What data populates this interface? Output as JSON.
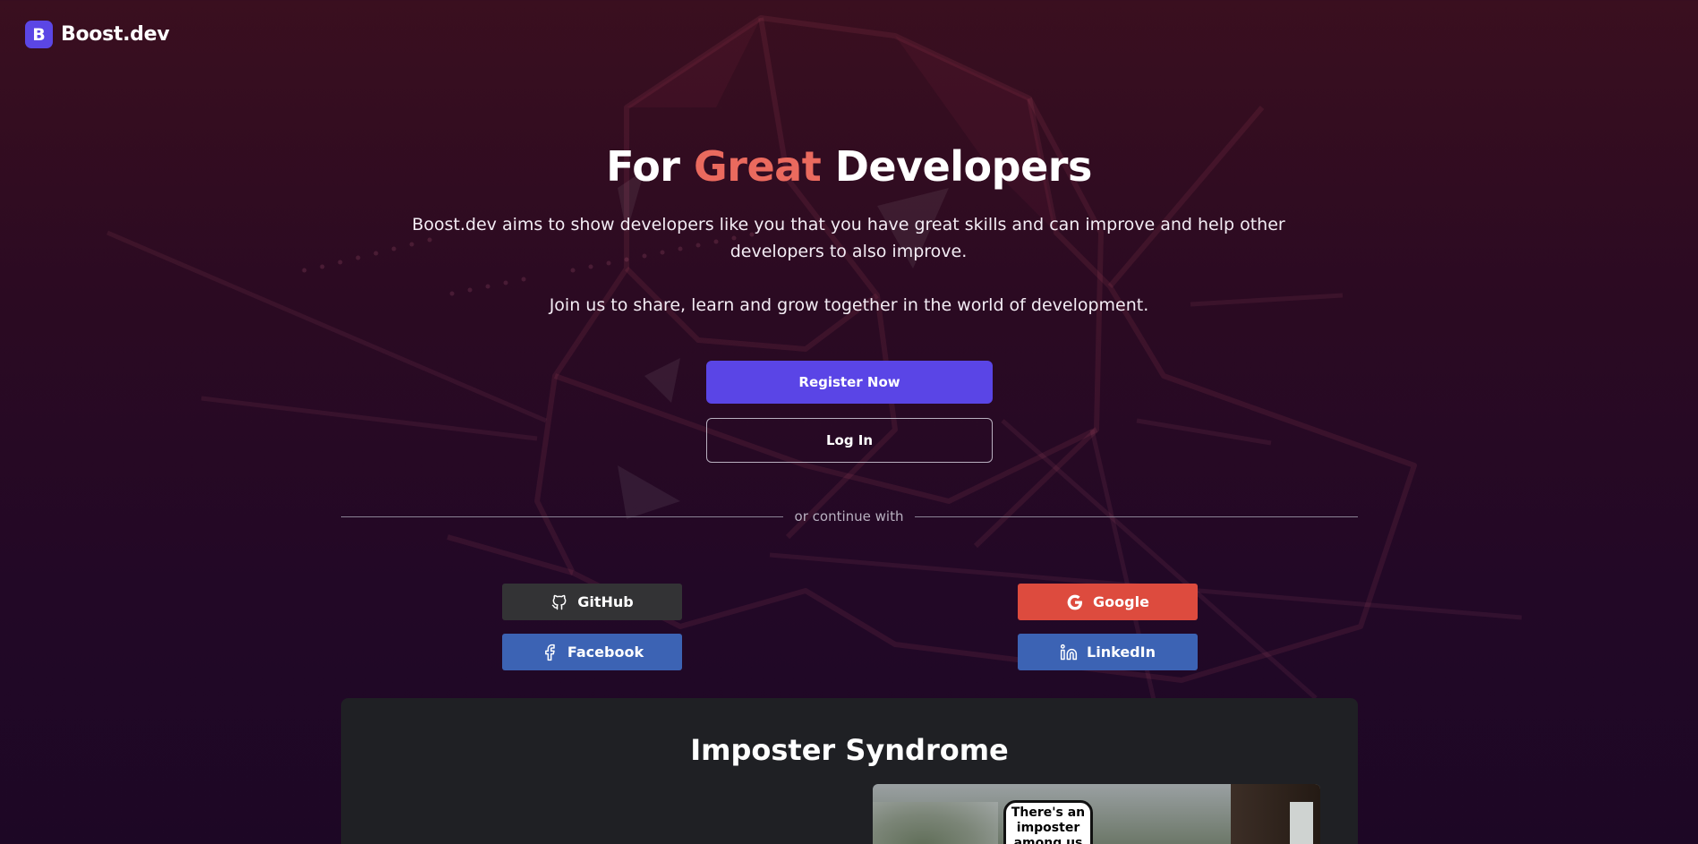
{
  "brand": {
    "mark": "B",
    "name": "Boost.dev",
    "accent_color": "#5b46e5"
  },
  "hero": {
    "title_prefix": "For",
    "title_accent": "Great",
    "title_suffix": "Developers",
    "accent_color": "#ea6a5e",
    "description": "Boost.dev aims to show developers like you that you have great skills and can improve and help other developers to also improve.",
    "subtext": "Join us to share, learn and grow together in the world of development."
  },
  "actions": {
    "register_label": "Register Now",
    "login_label": "Log In",
    "primary_color": "#5a45e6"
  },
  "divider": {
    "label": "or continue with"
  },
  "social": [
    {
      "id": "github",
      "label": "GitHub",
      "icon": "github-icon",
      "color": "#333335"
    },
    {
      "id": "google",
      "label": "Google",
      "icon": "google-icon",
      "color": "#dd4b3e"
    },
    {
      "id": "facebook",
      "label": "Facebook",
      "icon": "facebook-icon",
      "color": "#3c63b4"
    },
    {
      "id": "linkedin",
      "label": "LinkedIn",
      "icon": "linkedin-icon",
      "color": "#3c63b4"
    }
  ],
  "article": {
    "title": "Imposter Syndrome",
    "meme_text": "There's an imposter among us"
  }
}
